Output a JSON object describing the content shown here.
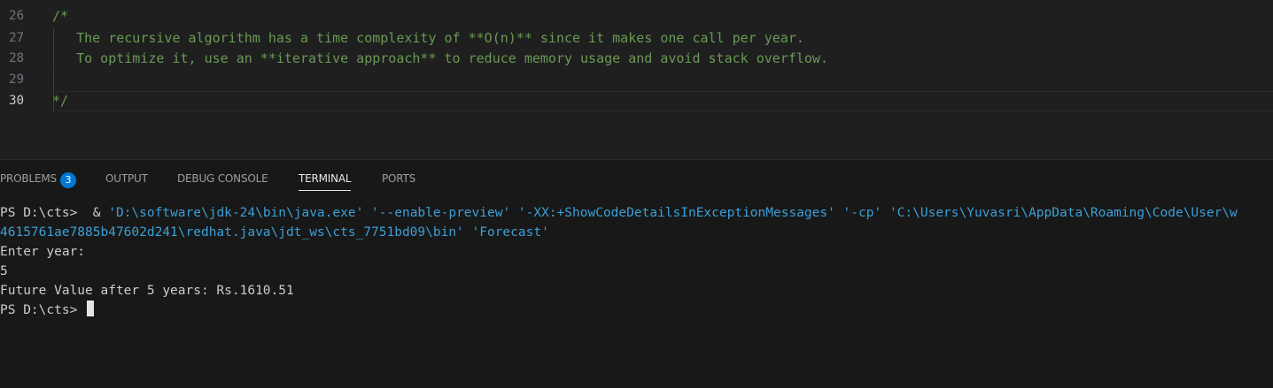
{
  "editor": {
    "lines": [
      {
        "number": "26",
        "text": "/*"
      },
      {
        "number": "27",
        "text": "   The recursive algorithm has a time complexity of **O(n)** since it makes one call per year."
      },
      {
        "number": "28",
        "text": "   To optimize it, use an **iterative approach** to reduce memory usage and avoid stack overflow."
      },
      {
        "number": "29",
        "text": ""
      },
      {
        "number": "30",
        "text": "*/"
      }
    ]
  },
  "panel": {
    "tabs": {
      "problems": "PROBLEMS",
      "problems_count": "3",
      "output": "OUTPUT",
      "debug_console": "DEBUG CONSOLE",
      "terminal": "TERMINAL",
      "ports": "PORTS"
    },
    "active_tab": "TERMINAL"
  },
  "terminal": {
    "prompt": "PS D:\\cts> ",
    "command_prefix": " & ",
    "command_args_line1": "'D:\\software\\jdk-24\\bin\\java.exe' '--enable-preview' '-XX:+ShowCodeDetailsInExceptionMessages' '-cp' 'C:\\Users\\Yuvasri\\AppData\\Roaming\\Code\\User\\w",
    "command_args_line2": "4615761ae7885b47602d241\\redhat.java\\jdt_ws\\cts_7751bd09\\bin' 'Forecast'",
    "output_line1": "Enter year:",
    "output_line2": "5",
    "output_line3": "Future Value after 5 years: Rs.1610.51",
    "final_prompt": "PS D:\\cts> "
  },
  "colors": {
    "comment": "#6a9955",
    "terminal_arg": "#3b9fd6",
    "badge": "#0078d4",
    "editor_bg": "#1f1f1f",
    "panel_bg": "#181818"
  }
}
